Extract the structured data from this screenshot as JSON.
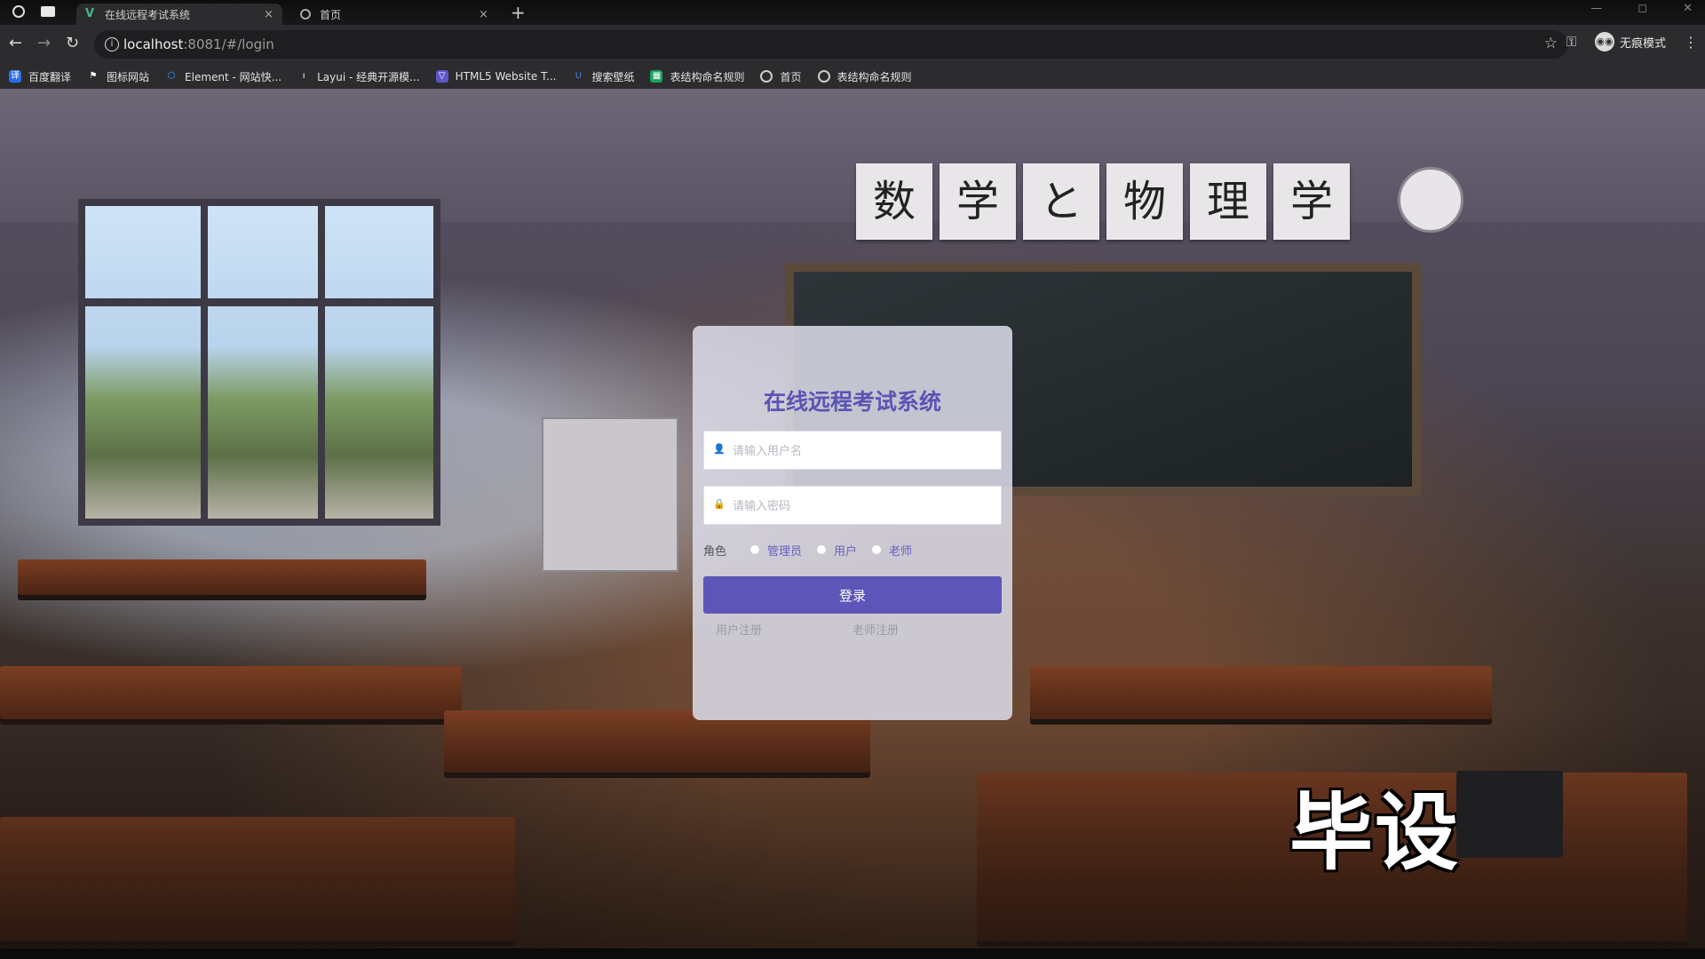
{
  "browser": {
    "tabs": [
      {
        "title": "在线远程考试系统",
        "active": true,
        "favicon": "vue-icon"
      },
      {
        "title": "首页",
        "active": false,
        "favicon": "globe-icon"
      }
    ],
    "new_tab": "+",
    "address": {
      "host": "localhost",
      "path": ":8081/#/login"
    },
    "incognito_label": "无痕模式",
    "bookmarks": [
      {
        "label": "百度翻译",
        "icon": "translate-icon",
        "color": "#2b6de8"
      },
      {
        "label": "图标网站",
        "icon": "flag-icon",
        "color": "#444"
      },
      {
        "label": "Element - 网站快...",
        "icon": "element-icon",
        "color": "#409eff"
      },
      {
        "label": "Layui - 经典开源模...",
        "icon": "layui-icon",
        "color": "#555"
      },
      {
        "label": "HTML5 Website T...",
        "icon": "html5-icon",
        "color": "#5d56c8"
      },
      {
        "label": "搜索壁纸",
        "icon": "wallpaper-icon",
        "color": "#4a7be0"
      },
      {
        "label": "表结构命名规则",
        "icon": "table-icon",
        "color": "#1aa260"
      },
      {
        "label": "首页",
        "icon": "globe-icon",
        "color": "#555"
      },
      {
        "label": "表结构命名规则",
        "icon": "globe-icon",
        "color": "#555"
      }
    ]
  },
  "scene": {
    "sign_cards": [
      "数",
      "学",
      "と",
      "物",
      "理",
      "学"
    ]
  },
  "login": {
    "title": "在线远程考试系统",
    "username_placeholder": "请输入用户名",
    "password_placeholder": "请输入密码",
    "role_label": "角色",
    "roles": [
      "管理员",
      "用户",
      "老师"
    ],
    "login_button": "登录",
    "register_user": "用户注册",
    "register_teacher": "老师注册"
  },
  "overlay": {
    "watermark": "毕设"
  },
  "colors": {
    "accent": "#5d56b8",
    "title": "#5b54b4"
  }
}
